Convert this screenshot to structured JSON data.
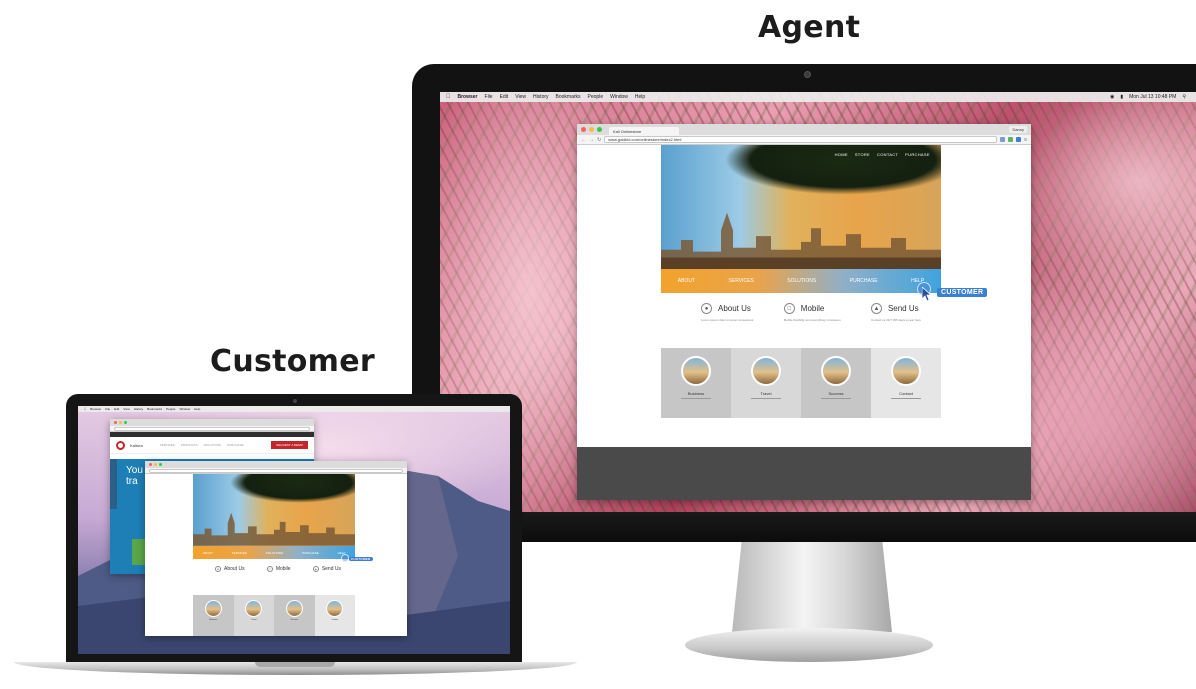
{
  "labels": {
    "agent": "Agent",
    "customer": "Customer"
  },
  "mac_menubar": {
    "items": [
      "Browser",
      "File",
      "Edit",
      "View",
      "History",
      "Bookmarks",
      "People",
      "Window",
      "Help"
    ],
    "clock": "Mon Jul 13 10:48 PM"
  },
  "agent_browser": {
    "tab_title": "Kall Onlinestore",
    "user_button": "Danny",
    "url": "www.goldkid.com/onlinestore/index2.html"
  },
  "site": {
    "top_nav": [
      "HOME",
      "STORE",
      "CONTACT",
      "PURCHASE"
    ],
    "menu": [
      "ABOUT",
      "SERVICES",
      "SOLUTIONS",
      "PURCHASE",
      "HELP"
    ],
    "features": [
      {
        "icon": "camera-icon",
        "title": "About Us",
        "sub": "Lorem ipsum dolor sit amet consectetur"
      },
      {
        "icon": "phone-icon",
        "title": "Mobile",
        "sub": "Mobile flexibility and everything in between"
      },
      {
        "icon": "send-icon",
        "title": "Send Us",
        "sub": "Contact us 24/7 365 days a year here"
      }
    ],
    "tiles": [
      {
        "title": "Business"
      },
      {
        "title": "Travel"
      },
      {
        "title": "Success"
      },
      {
        "title": "Contact"
      }
    ]
  },
  "cursor_badge": "CUSTOMER",
  "customer_back_browser": {
    "brand": "Kaltura",
    "nav": [
      "SERVICES",
      "PRODUCTS",
      "SOLUTIONS",
      "PURCHASE"
    ],
    "cta": "REQUEST A DEMO",
    "headline_1": "You",
    "headline_2": "tra"
  },
  "colors": {
    "menu_orange": "#f2a32c",
    "menu_blue": "#3fa3de",
    "badge_blue": "#3a7fd0",
    "kaltura_red": "#c4242b"
  }
}
